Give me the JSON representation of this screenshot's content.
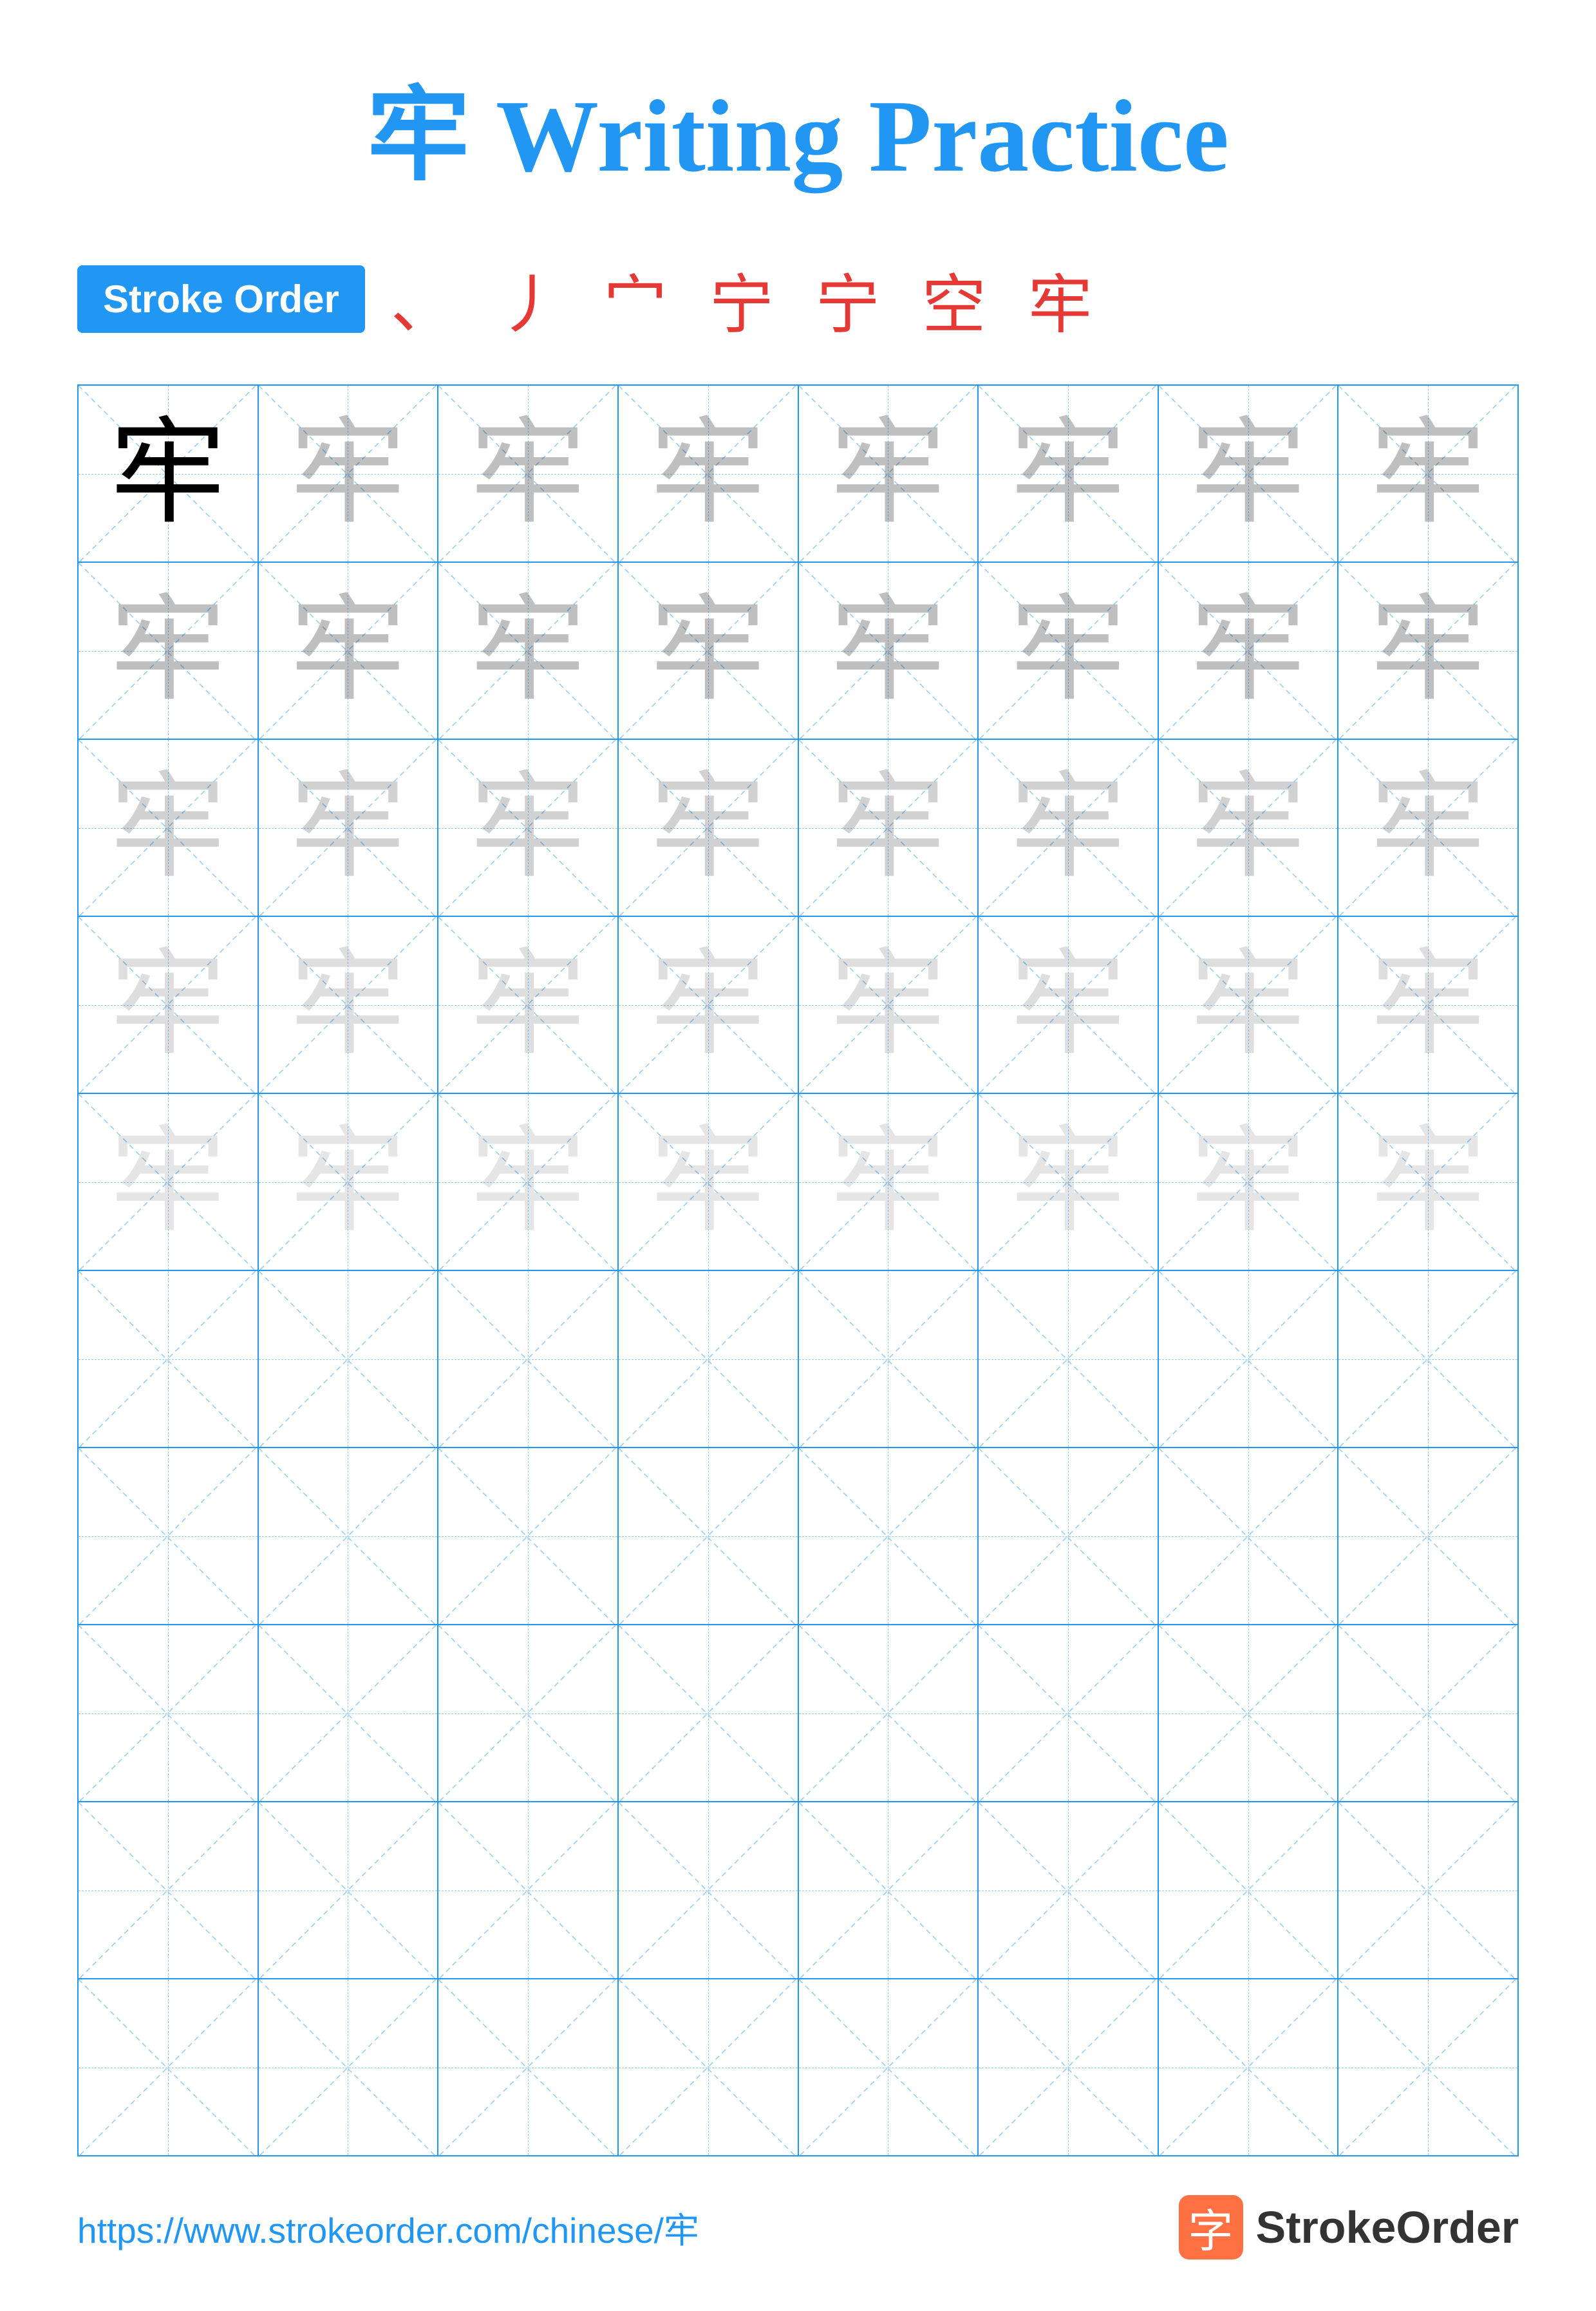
{
  "title": {
    "char": "牢",
    "suffix": " Writing Practice"
  },
  "stroke_order": {
    "badge_label": "Stroke Order",
    "chars": "、 丿 宀 宁 宁 空 牢"
  },
  "grid": {
    "rows": 10,
    "cols": 8,
    "practice_char": "牢",
    "filled_rows": 5,
    "opacity_levels": [
      1.0,
      0.28,
      0.22,
      0.16,
      0.12
    ]
  },
  "footer": {
    "url": "https://www.strokeorder.com/chinese/牢",
    "brand_name": "StrokeOrder",
    "logo_char": "字"
  }
}
